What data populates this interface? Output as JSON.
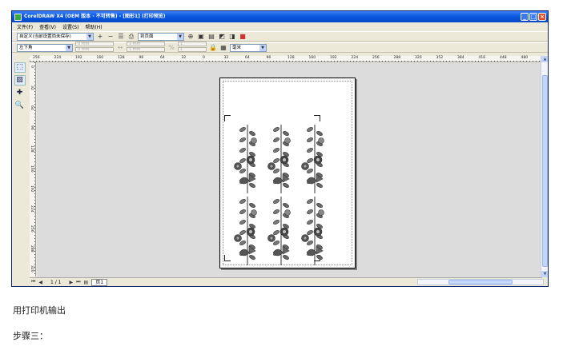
{
  "window": {
    "title": "CorelDRAW X4 (OEM 版本 - 不可转售) - [图形1] (打印预览)",
    "buttons": {
      "minimize": "_",
      "maximize": "□",
      "close": "×"
    }
  },
  "menu": [
    "文件(F)",
    "查看(V)",
    "设置(S)",
    "帮助(H)"
  ],
  "toolbar1": {
    "print_style": "自定义(当前设置尚未保存)",
    "page_mode": "到页面"
  },
  "toolbar2": {
    "position": "左下角",
    "spin_x": "0 mm",
    "spin_y": "0 mm",
    "spin_w": "1 mm",
    "spin_h": "1 mm",
    "spin_c1": "1",
    "spin_c2": "1",
    "units": "毫米"
  },
  "ruler_h_ticks": [
    "256",
    "224",
    "192",
    "160",
    "128",
    "96",
    "64",
    "32",
    "0",
    "32",
    "64",
    "96",
    "128",
    "160",
    "192",
    "224",
    "256",
    "288",
    "320",
    "352",
    "384",
    "416",
    "448",
    "480"
  ],
  "ruler_v_ticks": [
    "0",
    "32",
    "64",
    "96",
    "128",
    "160",
    "192",
    "224",
    "256",
    "288",
    "320"
  ],
  "status": {
    "page_count": "1 / 1",
    "page_tab": "页1"
  },
  "captions": {
    "line1": "用打印机输出",
    "line2": "步骤三："
  },
  "colors": {
    "titlebar": "#0a58e0",
    "window_bg": "#ece9d8",
    "canvas_bg": "#dcdcdc",
    "motif": "#555555"
  }
}
